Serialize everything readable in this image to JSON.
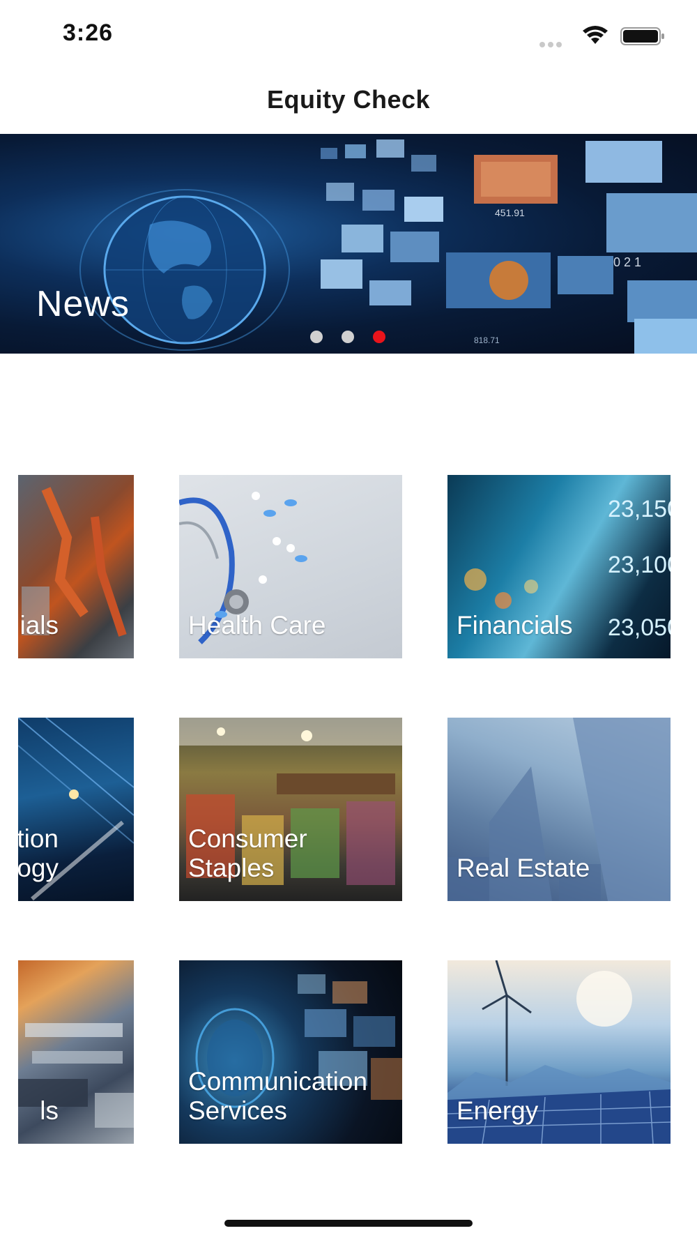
{
  "status_bar": {
    "time": "3:26"
  },
  "nav": {
    "title": "Equity Check"
  },
  "hero": {
    "label": "News",
    "pages": 3,
    "active_page": 3,
    "dot_active_color": "#e8141b",
    "dot_inactive_color": "#d0d0d0"
  },
  "sectors": [
    {
      "label": "ials"
    },
    {
      "label": "Health Care"
    },
    {
      "label": "Financials"
    },
    {
      "label": "ation\nlogy"
    },
    {
      "label": "Consumer\nStaples"
    },
    {
      "label": "Real Estate"
    },
    {
      "label": "ls"
    },
    {
      "label": "Communication\nServices"
    },
    {
      "label": "Energy"
    }
  ]
}
